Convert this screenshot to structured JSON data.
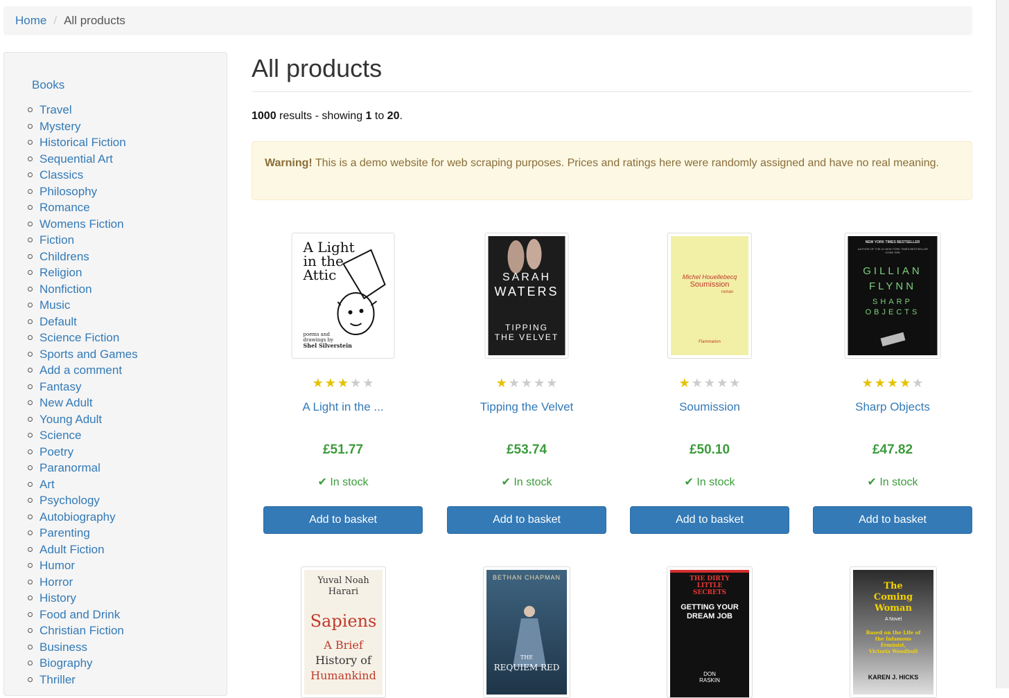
{
  "breadcrumb": {
    "home": "Home",
    "current": "All products"
  },
  "sidebar": {
    "root": "Books",
    "categories": [
      "Travel",
      "Mystery",
      "Historical Fiction",
      "Sequential Art",
      "Classics",
      "Philosophy",
      "Romance",
      "Womens Fiction",
      "Fiction",
      "Childrens",
      "Religion",
      "Nonfiction",
      "Music",
      "Default",
      "Science Fiction",
      "Sports and Games",
      "Add a comment",
      "Fantasy",
      "New Adult",
      "Young Adult",
      "Science",
      "Poetry",
      "Paranormal",
      "Art",
      "Psychology",
      "Autobiography",
      "Parenting",
      "Adult Fiction",
      "Humor",
      "Horror",
      "History",
      "Food and Drink",
      "Christian Fiction",
      "Business",
      "Biography",
      "Thriller"
    ]
  },
  "main": {
    "title": "All products",
    "results": {
      "total": "1000",
      "text_mid": " results - showing ",
      "from": "1",
      "to_word": " to ",
      "to": "20",
      "end": "."
    },
    "alert": {
      "label": "Warning!",
      "text": " This is a demo website for web scraping purposes. Prices and ratings here were randomly assigned and have no real meaning."
    }
  },
  "products": [
    {
      "title": "A Light in the ...",
      "rating": 3,
      "price": "£51.77",
      "stock": "In stock",
      "button": "Add to basket",
      "cover": {
        "lines": [
          "A Light",
          "in the",
          "Attic"
        ],
        "byline": [
          "poems and",
          "drawings by",
          "Shel Silverstein"
        ]
      }
    },
    {
      "title": "Tipping the Velvet",
      "rating": 1,
      "price": "£53.74",
      "stock": "In stock",
      "button": "Add to basket",
      "cover": {
        "lines": [
          "SARAH",
          "WATERS",
          "TIPPING",
          "THE VELVET"
        ]
      }
    },
    {
      "title": "Soumission",
      "rating": 1,
      "price": "£50.10",
      "stock": "In stock",
      "button": "Add to basket",
      "cover": {
        "lines": [
          "Michel Houellebecq",
          "Soumission",
          "roman",
          "Flammarion"
        ]
      }
    },
    {
      "title": "Sharp Objects",
      "rating": 4,
      "price": "£47.82",
      "stock": "In stock",
      "button": "Add to basket",
      "cover": {
        "lines": [
          "NEW YORK TIMES BESTSELLER",
          "AUTHOR OF THE #1 NEW YORK TIMES BESTSELLER GONE GIRL",
          "GILLIAN",
          "FLYNN",
          "SHARP",
          "OBJECTS"
        ]
      }
    },
    {
      "cover": {
        "lines": [
          "Yuval Noah",
          "Harari",
          "Sapiens",
          "A Brief",
          "History of",
          "Humankind"
        ]
      }
    },
    {
      "cover": {
        "lines": [
          "BETHAN CHAPMAN",
          "THE",
          "REQUIEM RED"
        ]
      }
    },
    {
      "cover": {
        "lines": [
          "THE DIRTY",
          "LITTLE",
          "SECRETS",
          "GETTING YOUR",
          "DREAM JOB",
          "DON",
          "RASKIN"
        ]
      }
    },
    {
      "cover": {
        "lines": [
          "The",
          "Coming",
          "Woman",
          "A Novel",
          "Based on the Life of",
          "the Infamous",
          "Feminist,",
          "Victoria Woodhull",
          "KAREN J. HICKS"
        ]
      }
    }
  ],
  "colors": {
    "link": "#337ab7",
    "price": "#3c9b3c",
    "star_on": "#e5c200",
    "star_off": "#cccccc",
    "button": "#337ab7",
    "alert_bg": "#fcf8e3",
    "alert_text": "#8a6d3b"
  },
  "icons": {
    "star": "star-icon",
    "check": "check-icon",
    "bullet": "circle-bullet-icon"
  }
}
